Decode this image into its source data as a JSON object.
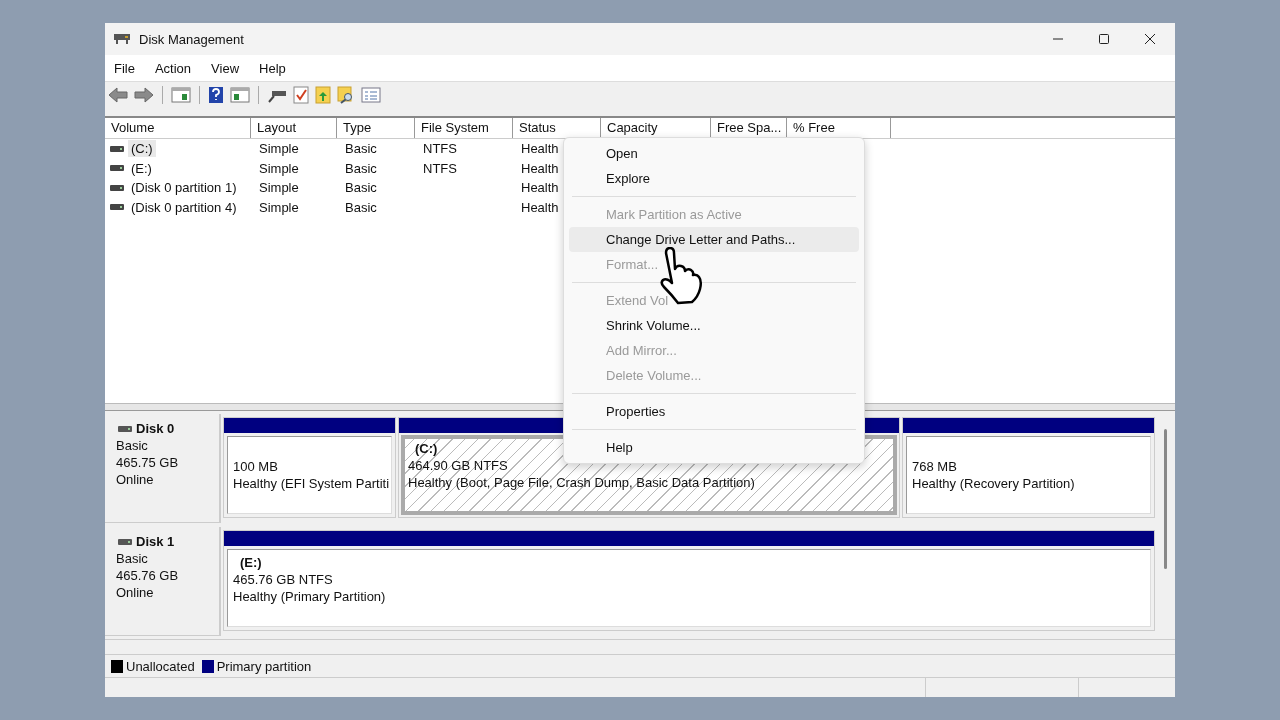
{
  "window": {
    "title": "Disk Management"
  },
  "menu": [
    "File",
    "Action",
    "View",
    "Help"
  ],
  "volume_table": {
    "columns": [
      "Volume",
      "Layout",
      "Type",
      "File System",
      "Status",
      "Capacity",
      "Free Spa...",
      "% Free"
    ],
    "rows": [
      {
        "selected": true,
        "cells": [
          "(C:)",
          "Simple",
          "Basic",
          "NTFS",
          "Health"
        ]
      },
      {
        "selected": false,
        "cells": [
          "(E:)",
          "Simple",
          "Basic",
          "NTFS",
          "Health"
        ]
      },
      {
        "selected": false,
        "cells": [
          "(Disk 0 partition 1)",
          "Simple",
          "Basic",
          "",
          "Health"
        ]
      },
      {
        "selected": false,
        "cells": [
          "(Disk 0 partition 4)",
          "Simple",
          "Basic",
          "",
          "Health"
        ]
      }
    ]
  },
  "context_menu": [
    {
      "kind": "item",
      "label": "Open",
      "disabled": false,
      "selected": false
    },
    {
      "kind": "item",
      "label": "Explore",
      "disabled": false,
      "selected": false
    },
    {
      "kind": "separator"
    },
    {
      "kind": "item",
      "label": "Mark Partition as Active",
      "disabled": true,
      "selected": false
    },
    {
      "kind": "item",
      "label": "Change Drive Letter and Paths...",
      "disabled": false,
      "selected": true
    },
    {
      "kind": "item",
      "label": "Format...",
      "disabled": true,
      "selected": false
    },
    {
      "kind": "separator"
    },
    {
      "kind": "item",
      "label": "Extend Vol",
      "disabled": true,
      "selected": false
    },
    {
      "kind": "item",
      "label": "Shrink Volume...",
      "disabled": false,
      "selected": false
    },
    {
      "kind": "item",
      "label": "Add Mirror...",
      "disabled": true,
      "selected": false
    },
    {
      "kind": "item",
      "label": "Delete Volume...",
      "disabled": true,
      "selected": false
    },
    {
      "kind": "separator"
    },
    {
      "kind": "item",
      "label": "Properties",
      "disabled": false,
      "selected": false
    },
    {
      "kind": "separator"
    },
    {
      "kind": "item",
      "label": "Help",
      "disabled": false,
      "selected": false
    }
  ],
  "disks": [
    {
      "name": "Disk 0",
      "type": "Basic",
      "size": "465.75 GB",
      "status": "Online",
      "partitions": [
        {
          "size": "100 MB",
          "status": "Healthy (EFI System Partiti",
          "selected": false
        },
        {
          "label": "(C:)",
          "size": "464.90 GB NTFS",
          "status": "Healthy (Boot, Page File, Crash Dump, Basic Data Partition)",
          "selected": true
        },
        {
          "size": "768 MB",
          "status": "Healthy (Recovery Partition)",
          "selected": false
        }
      ]
    },
    {
      "name": "Disk 1",
      "type": "Basic",
      "size": "465.76 GB",
      "status": "Online",
      "partitions": [
        {
          "label": "(E:)",
          "size": "465.76 GB NTFS",
          "status": "Healthy (Primary Partition)",
          "selected": false
        }
      ]
    }
  ],
  "legend": [
    {
      "label": "Unallocated",
      "color": "#000000"
    },
    {
      "label": "Primary partition",
      "color": "#000080"
    }
  ]
}
